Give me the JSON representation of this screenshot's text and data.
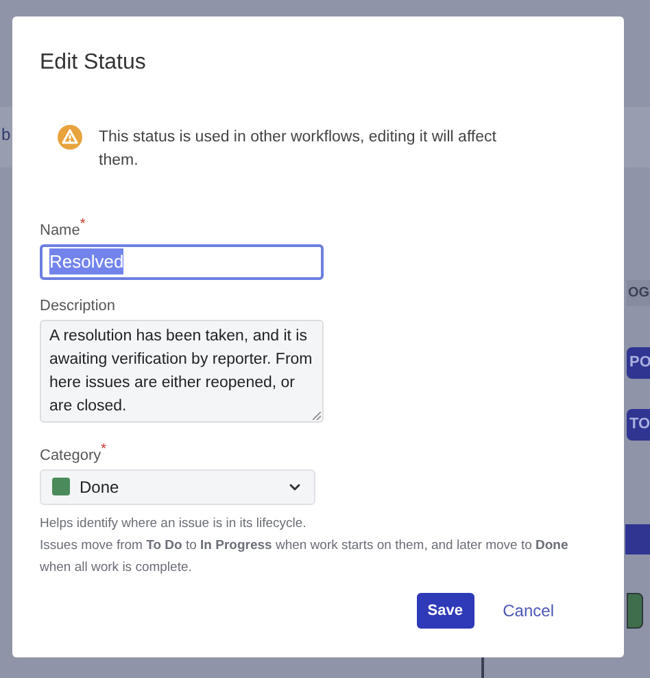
{
  "background": {
    "left_text": "b",
    "right_items": [
      {
        "kind": "label",
        "text": "OG"
      },
      {
        "kind": "chip",
        "text": "PO"
      },
      {
        "kind": "chip",
        "text": "TO"
      },
      {
        "kind": "bar"
      },
      {
        "kind": "node"
      }
    ]
  },
  "dialog": {
    "title": "Edit Status",
    "warning": "This status is used in other workflows, editing it will affect them.",
    "name": {
      "label": "Name",
      "required_mark": "*",
      "value": "Resolved",
      "focused": true
    },
    "description": {
      "label": "Description",
      "value": "A resolution has been taken, and it is awaiting verification by reporter. From here issues are either reopened, or are closed."
    },
    "category": {
      "label": "Category",
      "required_mark": "*",
      "value": "Done",
      "color": "#4b8a5b"
    },
    "help": [
      "Helps identify where an issue is in its lifecycle.",
      "Issues move from **To Do** to **In Progress** when work starts on them, and later move to **Done** when all work is complete."
    ],
    "buttons": [
      {
        "kind": "primary",
        "label": "Save"
      },
      {
        "kind": "subtle",
        "label": "Cancel"
      }
    ]
  }
}
